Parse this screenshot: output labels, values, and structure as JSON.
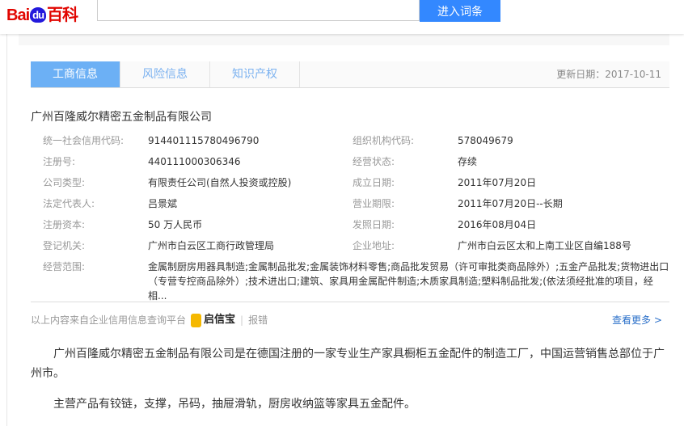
{
  "header": {
    "logo": "Bai du 百科",
    "logo_parts": [
      "Bai",
      "du",
      "百科"
    ],
    "search_value": "",
    "button": "进入词条"
  },
  "tabs": [
    {
      "label": "工商信息",
      "active": true
    },
    {
      "label": "风险信息"
    },
    {
      "label": "知识产权"
    }
  ],
  "update_date": "更新日期：2017-10-11",
  "company_name": "广州百隆威尔精密五金制品有限公司",
  "fields_left": [
    {
      "label": "统一社会信用代码:",
      "value": "914401115780496790"
    },
    {
      "label": "注册号:",
      "value": "440111000306346"
    },
    {
      "label": "公司类型:",
      "value": "有限责任公司(自然人投资或控股)"
    },
    {
      "label": "法定代表人:",
      "value": "吕景斌"
    },
    {
      "label": "注册资本:",
      "value": "50 万人民币"
    },
    {
      "label": "登记机关:",
      "value": "广州市白云区工商行政管理局"
    }
  ],
  "fields_right": [
    {
      "label": "组织机构代码:",
      "value": "578049679"
    },
    {
      "label": "经营状态:",
      "value": "存续"
    },
    {
      "label": "成立日期:",
      "value": "2011年07月20日"
    },
    {
      "label": "营业期限:",
      "value": "2011年07月20日--长期"
    },
    {
      "label": "发照日期:",
      "value": "2016年08月04日"
    },
    {
      "label": "企业地址:",
      "value": "广州市白云区太和上南工业区自编188号"
    }
  ],
  "scope": {
    "label": "经营范围:",
    "value": "金属制厨房用器具制造;金属制品批发;金属装饰材料零售;商品批发贸易（许可审批类商品除外）;五金产品批发;货物进出口（专营专控商品除外）;技术进出口;建筑、家具用金属配件制造;木质家具制造;塑料制品批发;(依法须经批准的项目，经相..."
  },
  "footer": {
    "source": "以上内容来自企业信用信息查询平台",
    "brand": "启信宝",
    "report": "报错",
    "more": "查看更多 >"
  },
  "paragraphs": [
    "广州百隆威尔精密五金制品有限公司是在德国注册的一家专业生产家具橱柜五金配件的制造工厂，中国运营销售总部位于广州市。",
    "主营产品有铰链，支撑，吊码，抽屉滑轨，厨房收纳篮等家具五金配件。"
  ]
}
